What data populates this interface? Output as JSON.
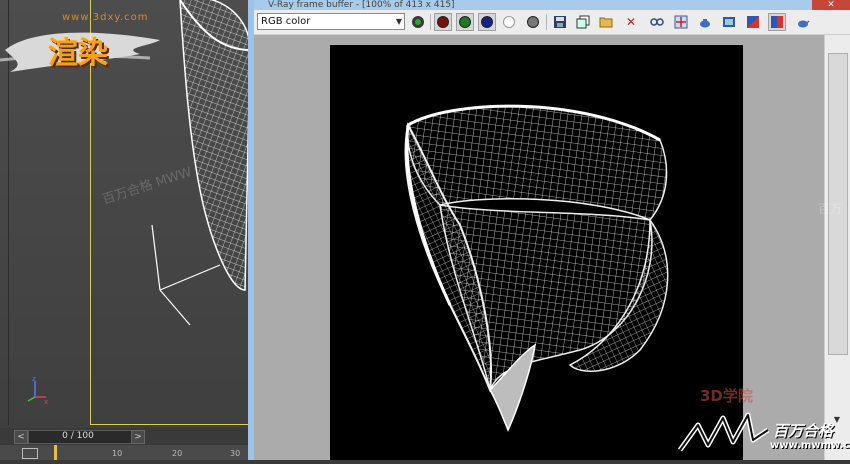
{
  "logo": {
    "title": "渲染",
    "site": "www.3dxy.com"
  },
  "viewport": {
    "watermark": "百万合格 MWW"
  },
  "timeline": {
    "counter": "0 / 100",
    "prev": "<",
    "next": ">",
    "ticks": [
      "10",
      "20",
      "30"
    ]
  },
  "vfb": {
    "title": "V-Ray frame buffer - [100% of 413 x 415]",
    "close": "✕",
    "channel": "RGB color",
    "toolbar": [
      {
        "name": "red-channel-icon",
        "color": "#b02020"
      },
      {
        "name": "green-channel-icon",
        "color": "#1f9a2a"
      },
      {
        "name": "blue-channel-icon",
        "color": "#1a2fa0"
      },
      {
        "name": "alpha-channel-icon",
        "color": "#ffffff"
      },
      {
        "name": "mono-icon",
        "color": "#888888"
      }
    ],
    "red_dot": "#7a0f0f",
    "scroll_down": "▼"
  },
  "watermarks": {
    "right": "百万",
    "bottom_3d": "3D学院"
  },
  "brand": {
    "name": "百万合格",
    "url": "www.mwmw.cn"
  }
}
